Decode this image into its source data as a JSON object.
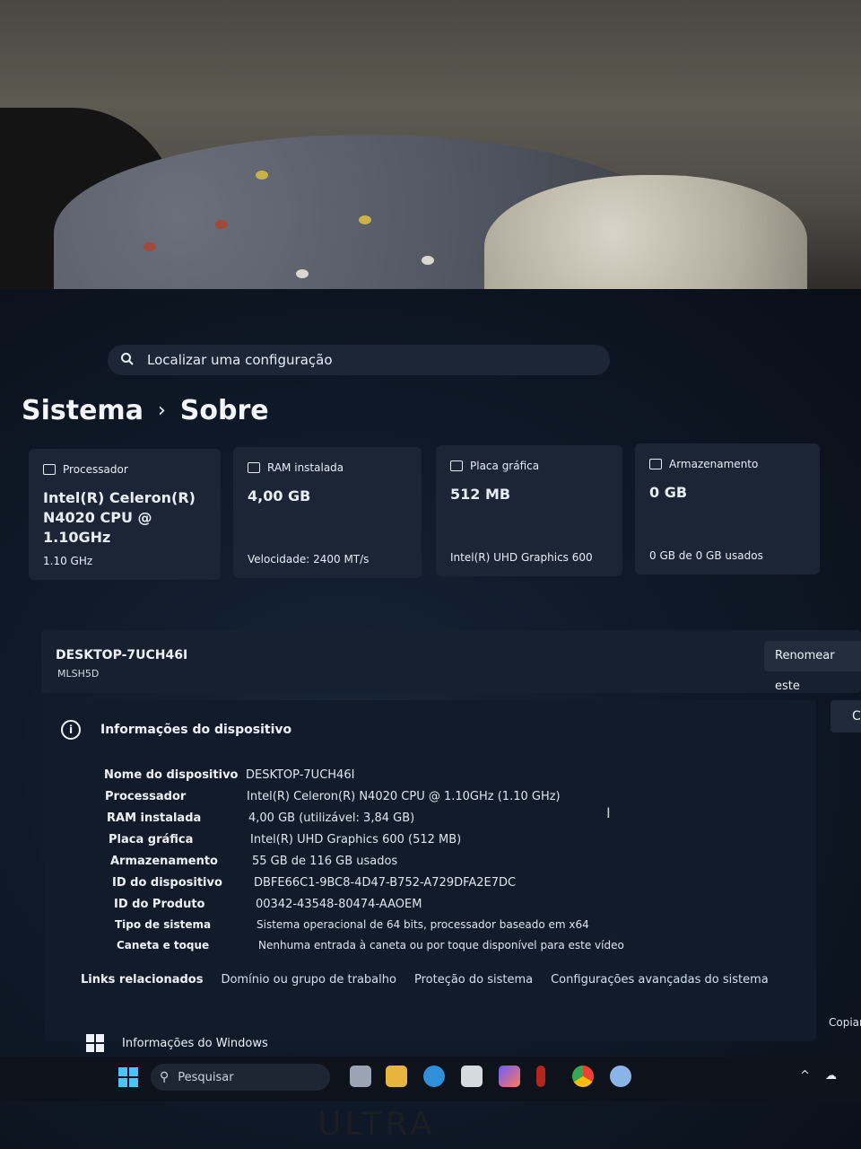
{
  "search": {
    "placeholder": "Localizar uma configuração",
    "icon": "search-icon"
  },
  "breadcrumb": {
    "parent": "Sistema",
    "separator": "›",
    "current": "Sobre"
  },
  "cards": [
    {
      "title": "Processador",
      "icon": "cpu-icon",
      "value_line1": "Intel(R) Celeron(R)",
      "value_line2": "N4020 CPU @ 1.10GHz",
      "sub": "1.10 GHz"
    },
    {
      "title": "RAM instalada",
      "icon": "ram-icon",
      "value_line1": "4,00 GB",
      "value_line2": "",
      "sub": "Velocidade: 2400 MT/s"
    },
    {
      "title": "Placa gráfica",
      "icon": "gpu-icon",
      "value_line1": "512 MB",
      "value_line2": "",
      "sub": "Intel(R) UHD Graphics 600"
    },
    {
      "title": "Armazenamento",
      "icon": "storage-icon",
      "value_line1": "0 GB",
      "value_line2": "",
      "sub": "0 GB de 0 GB usados"
    }
  ],
  "device": {
    "name": "DESKTOP-7UCH46I",
    "model": "MLSH5D",
    "rename_label": "Renomear este"
  },
  "info": {
    "heading": "Informações do dispositivo",
    "copy_label": "Co",
    "rows": [
      {
        "key": "Nome do dispositivo",
        "value": "DESKTOP-7UCH46I"
      },
      {
        "key": "Processador",
        "value": "Intel(R) Celeron(R) N4020 CPU @ 1.10GHz (1.10 GHz)"
      },
      {
        "key": "RAM instalada",
        "value": "4,00 GB (utilizável: 3,84 GB)"
      },
      {
        "key": "Placa gráfica",
        "value": "Intel(R) UHD Graphics 600 (512 MB)"
      },
      {
        "key": "Armazenamento",
        "value": "55 GB de 116 GB usados"
      },
      {
        "key": "ID do dispositivo",
        "value": "DBFE66C1-9BC8-4D47-B752-A729DFA2E7DC"
      },
      {
        "key": "ID do Produto",
        "value": "00342-43548-80474-AAOEM"
      },
      {
        "key": "Tipo de sistema",
        "value": "Sistema operacional de 64 bits, processador baseado em x64"
      },
      {
        "key": "Caneta e toque",
        "value": "Nenhuma entrada à caneta ou por toque disponível para este vídeo"
      }
    ]
  },
  "links": {
    "label": "Links relacionados",
    "items": [
      "Domínio ou grupo de trabalho",
      "Proteção do sistema",
      "Configurações avançadas do sistema"
    ]
  },
  "windows_info": {
    "label": "Informações do Windows",
    "copy_label": "Copiar"
  },
  "taskbar": {
    "search_label": "Pesquisar"
  },
  "bezel_brand": "ULTRA"
}
